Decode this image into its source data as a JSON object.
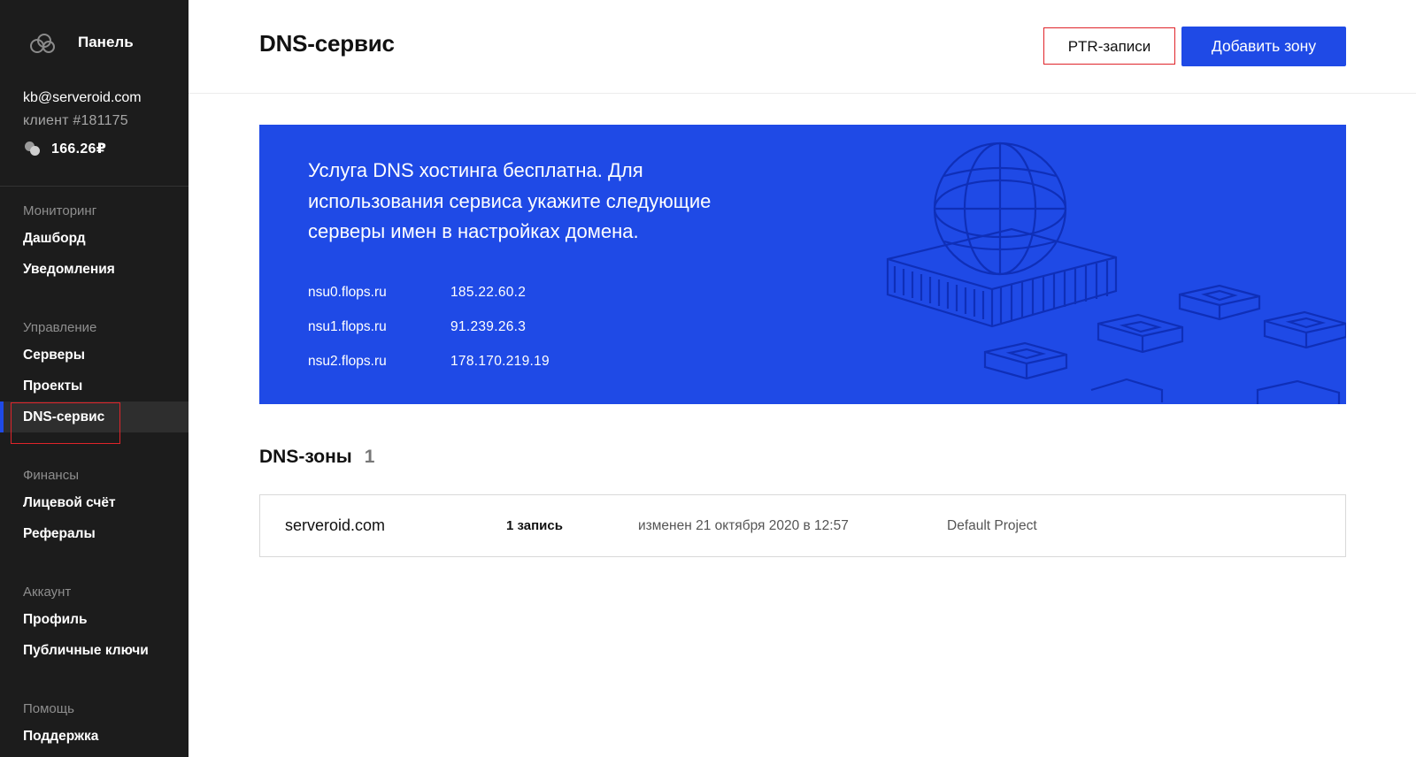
{
  "sidebar": {
    "brand_title": "Панель",
    "account": {
      "email": "kb@serveroid.com",
      "client": "клиент #181175",
      "balance": "166.26₽"
    },
    "groups": [
      {
        "heading": "Мониторинг",
        "items": [
          {
            "label": "Дашборд"
          },
          {
            "label": "Уведомления"
          }
        ]
      },
      {
        "heading": "Управление",
        "items": [
          {
            "label": "Серверы"
          },
          {
            "label": "Проекты"
          },
          {
            "label": "DNS-сервис",
            "active": true
          }
        ]
      },
      {
        "heading": "Финансы",
        "items": [
          {
            "label": "Лицевой счёт"
          },
          {
            "label": "Рефералы"
          }
        ]
      },
      {
        "heading": "Аккаунт",
        "items": [
          {
            "label": "Профиль"
          },
          {
            "label": "Публичные ключи"
          }
        ]
      },
      {
        "heading": "Помощь",
        "items": [
          {
            "label": "Поддержка"
          }
        ]
      }
    ]
  },
  "header": {
    "title": "DNS-сервис",
    "ptr_label": "PTR-записи",
    "add_zone_label": "Добавить зону"
  },
  "banner": {
    "text": "Услуга DNS хостинга бесплатна. Для использования сервиса укажите следующие серверы имен в настройках домена.",
    "nameservers": [
      {
        "host": "nsu0.flops.ru",
        "ip": "185.22.60.2"
      },
      {
        "host": "nsu1.flops.ru",
        "ip": "91.239.26.3"
      },
      {
        "host": "nsu2.flops.ru",
        "ip": "178.170.219.19"
      }
    ]
  },
  "zones": {
    "title": "DNS-зоны",
    "count": "1",
    "rows": [
      {
        "name": "serveroid.com",
        "records": "1 запись",
        "modified": "изменен 21 октября 2020 в 12:57",
        "project": "Default Project"
      }
    ]
  },
  "colors": {
    "accent": "#1f4ae6",
    "sidebar_bg": "#1c1c1c",
    "highlight": "#e0242a"
  }
}
